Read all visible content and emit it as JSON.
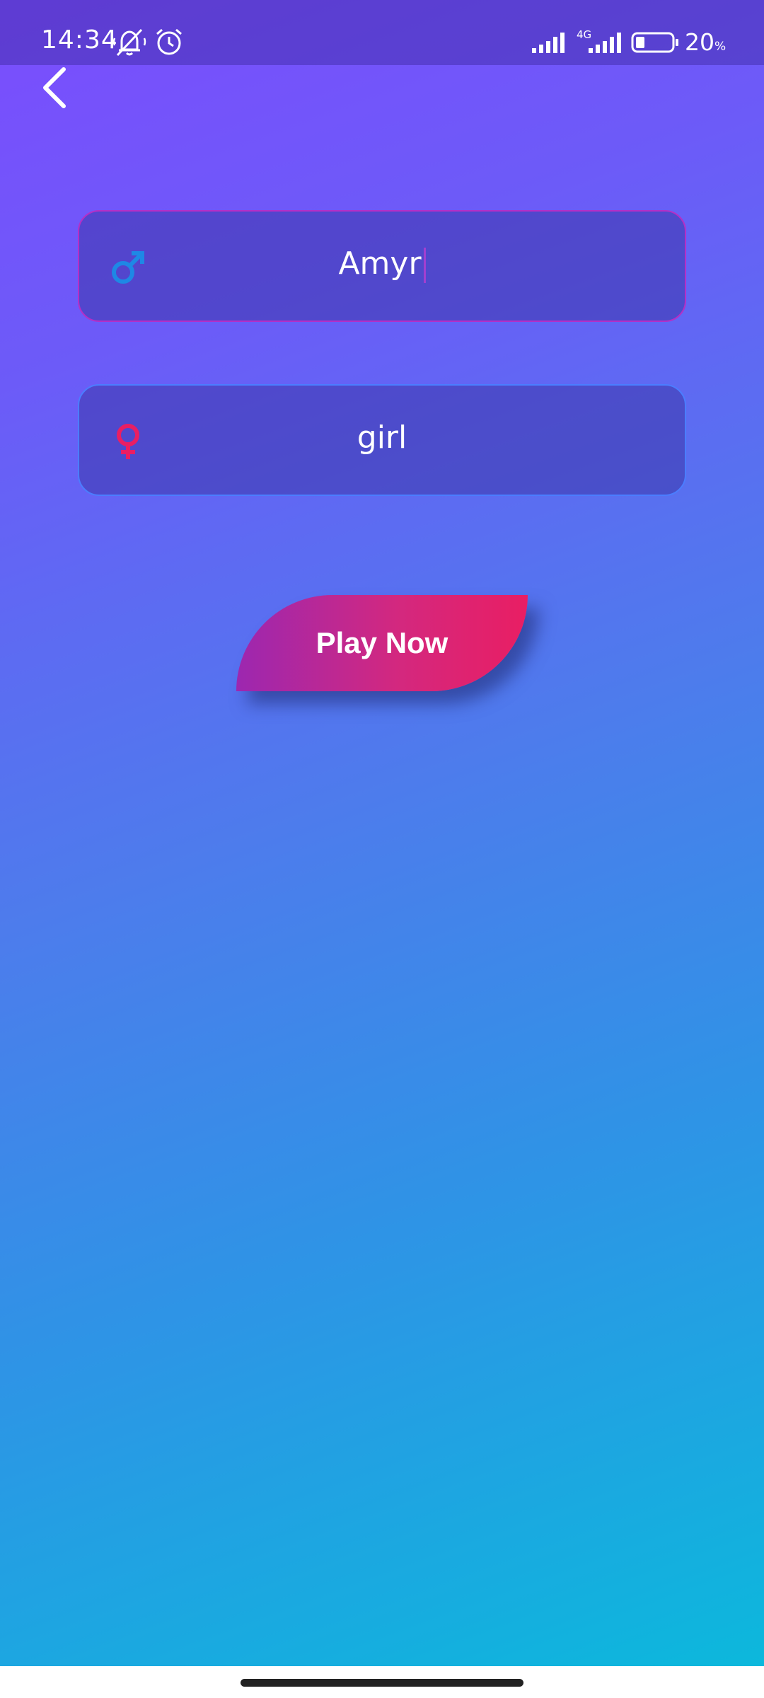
{
  "status_bar": {
    "time": "14:34",
    "network_type": "4G",
    "battery_value": "20",
    "battery_unit": "%"
  },
  "icons": {
    "back": "back-arrow-icon",
    "name_field": "male-icon",
    "gender_field": "female-icon"
  },
  "form": {
    "name_value": "Amyr",
    "gender_value": "girl"
  },
  "actions": {
    "play_label": "Play Now"
  },
  "colors": {
    "male_icon": "#1e88e5",
    "female_icon": "#e91e63",
    "button_start": "#9c27b0",
    "button_end": "#e91e63",
    "name_border": "#b52fc6",
    "gender_border": "#4b7dff"
  }
}
